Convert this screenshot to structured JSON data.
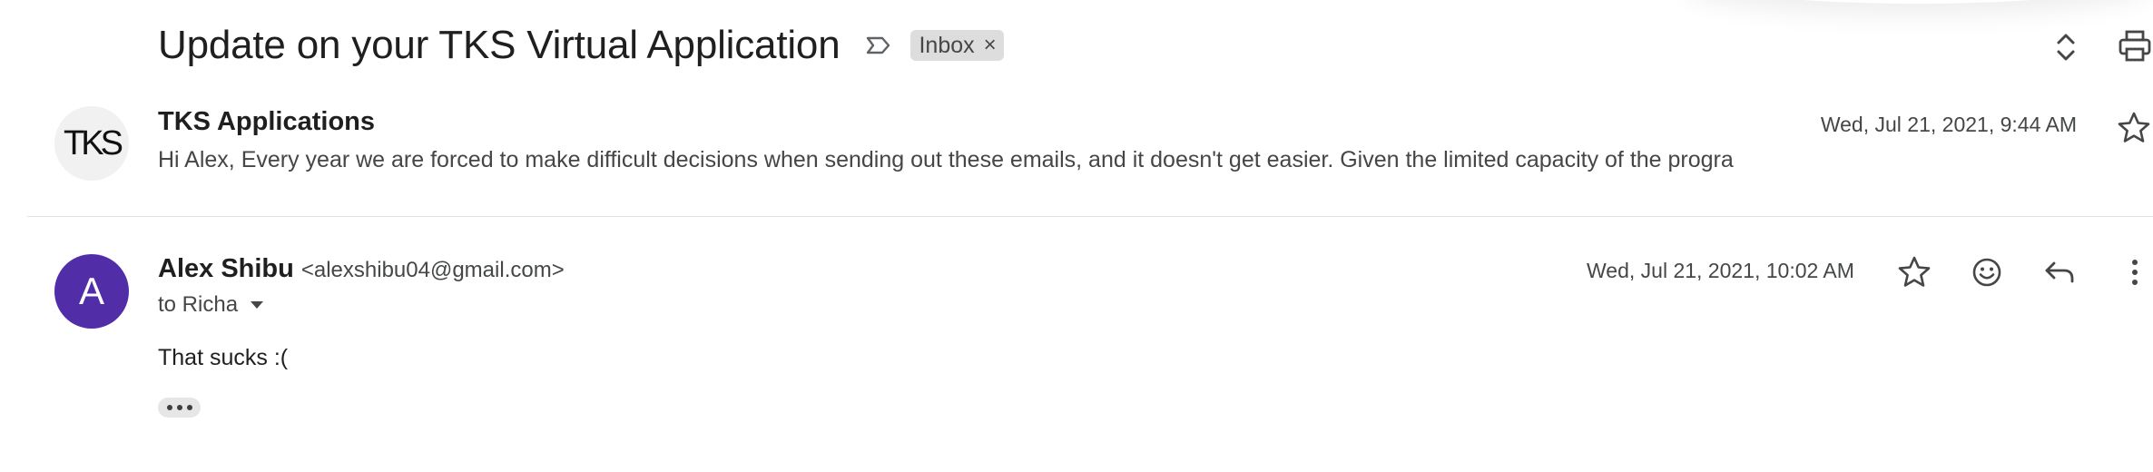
{
  "thread": {
    "subject": "Update on your TKS Virtual Application",
    "label": "Inbox",
    "label_remove": "×"
  },
  "messages": [
    {
      "avatar_text": "TKS",
      "sender": "TKS Applications",
      "snippet": "Hi Alex, Every year we are forced to make difficult decisions when sending out these emails, and it doesn't get easier. Given the limited capacity of the progra",
      "date": "Wed, Jul 21, 2021, 9:44 AM"
    },
    {
      "avatar_text": "A",
      "sender": "Alex Shibu",
      "email": "<alexshibu04@gmail.com>",
      "recipient": "to Richa",
      "date": "Wed, Jul 21, 2021, 10:02 AM",
      "body": "That sucks :("
    }
  ],
  "icons": {
    "importance": "importance-marker-icon",
    "expand": "expand-all-icon",
    "print": "print-icon",
    "star": "star-icon",
    "emoji": "emoji-reaction-icon",
    "reply": "reply-icon",
    "more": "more-vert-icon",
    "caret": "caret-down-icon",
    "trimmed": "show-trimmed-content-icon"
  },
  "colors": {
    "avatar_accent": "#512da8",
    "label_chip": "#dddddd",
    "text_primary": "#1f1f1f",
    "text_secondary": "#444746"
  }
}
